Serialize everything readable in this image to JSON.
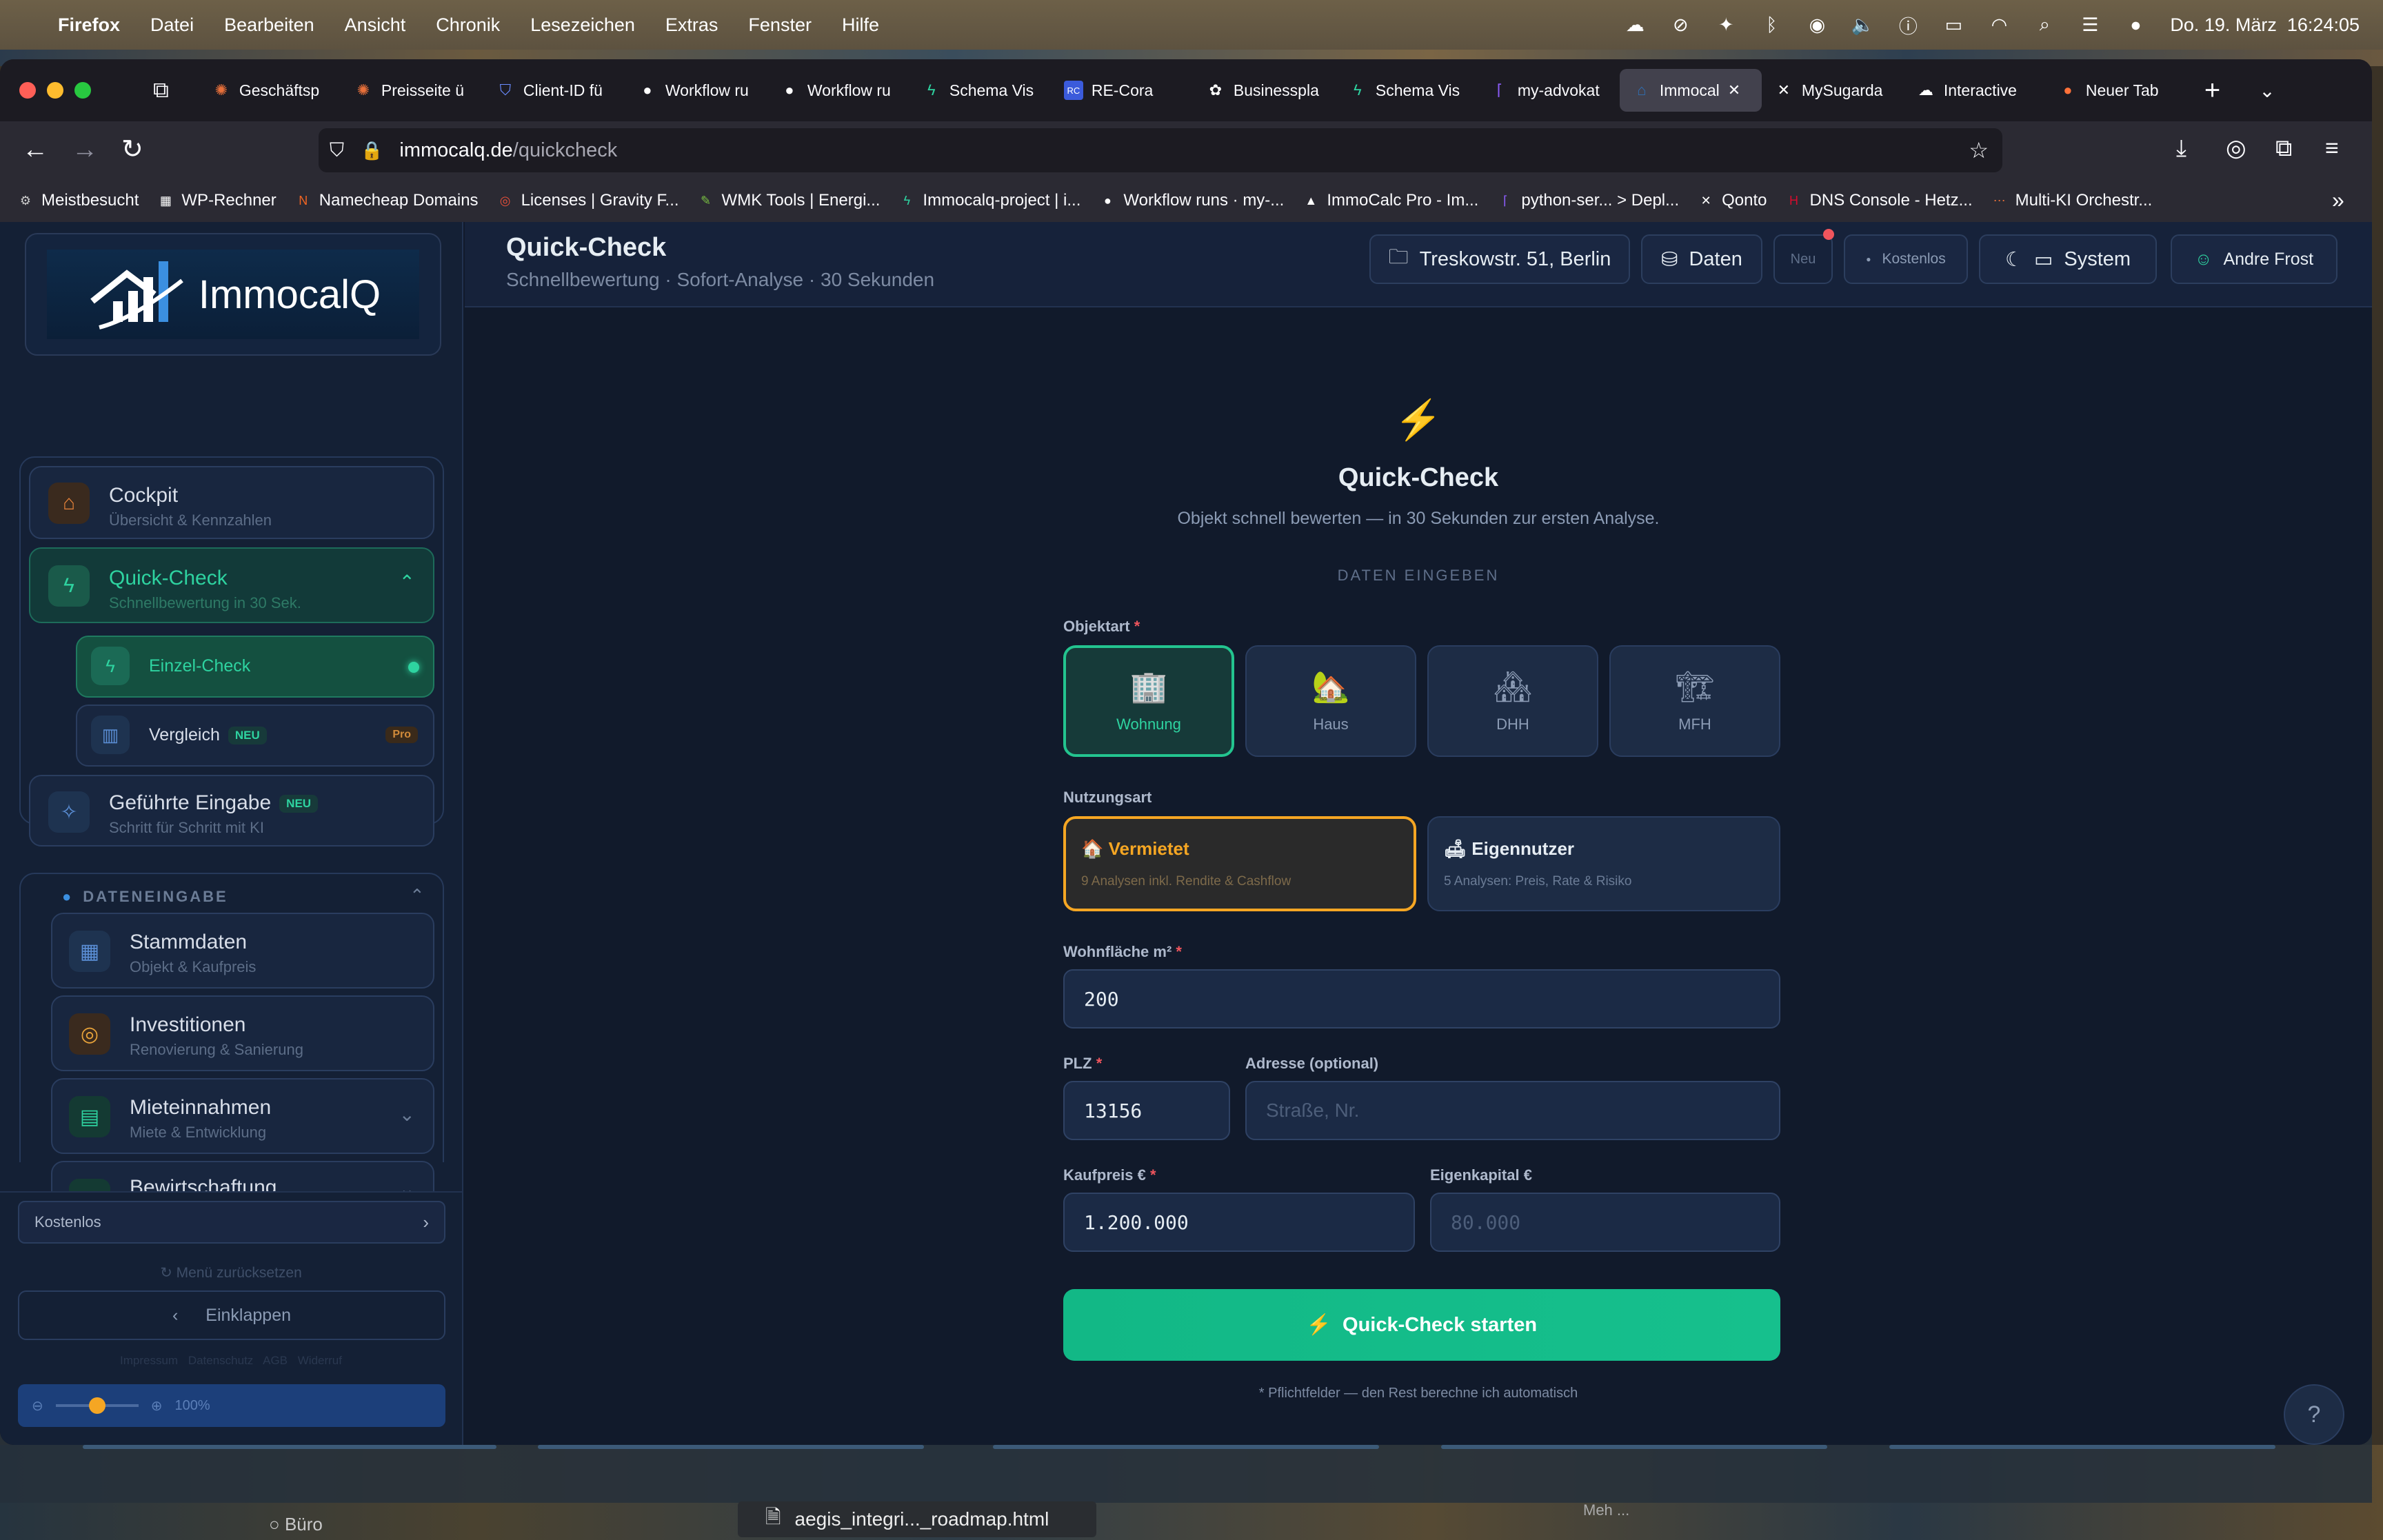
{
  "menubar": {
    "app": "Firefox",
    "items": [
      "Datei",
      "Bearbeiten",
      "Ansicht",
      "Chronik",
      "Lesezeichen",
      "Extras",
      "Fenster",
      "Hilfe"
    ],
    "clock": "Do. 19. März  16:24:05"
  },
  "tabs": [
    {
      "label": "Geschäftsp",
      "icon": "sparkle-icon",
      "color": "#e8703a"
    },
    {
      "label": "Preisseite ü",
      "icon": "sparkle-icon",
      "color": "#e8703a"
    },
    {
      "label": "Client-ID fü",
      "icon": "shield-icon",
      "color": "#6a8cff"
    },
    {
      "label": "Workflow ru",
      "icon": "github-icon",
      "color": "#ffffff"
    },
    {
      "label": "Workflow ru",
      "icon": "github-icon",
      "color": "#ffffff"
    },
    {
      "label": "Schema Vis",
      "icon": "bolt-icon",
      "color": "#2ed3a0"
    },
    {
      "label": "RE-Cora",
      "icon": "rc-icon",
      "color": "#3b5bdb"
    },
    {
      "label": "Businesspla",
      "icon": "openai-icon",
      "color": "#ffffff"
    },
    {
      "label": "Schema Vis",
      "icon": "bolt-icon",
      "color": "#2ed3a0"
    },
    {
      "label": "my-advokat",
      "icon": "bracket-icon",
      "color": "#8a5cf6"
    },
    {
      "label": "Immocal",
      "icon": "immocalq-icon",
      "color": "#2f6fb5"
    },
    {
      "label": "MySugarda",
      "icon": "x-icon",
      "color": "#ffffff"
    },
    {
      "label": "Interactive",
      "icon": "cloud-icon",
      "color": "#ffffff"
    },
    {
      "label": "Neuer Tab",
      "icon": "firefox-icon",
      "color": "#ff7139"
    }
  ],
  "url": {
    "domain": "immocalq.de",
    "path": "/quickcheck"
  },
  "bookmarks": [
    {
      "label": "Meistbesucht",
      "icon": "gear-icon",
      "color": "#cccccc"
    },
    {
      "label": "WP-Rechner",
      "icon": "page-icon",
      "color": "#ffffff"
    },
    {
      "label": "Namecheap Domains",
      "icon": "n-icon",
      "color": "#f26522"
    },
    {
      "label": "Licenses | Gravity F...",
      "icon": "gravity-icon",
      "color": "#e8503a"
    },
    {
      "label": "WMK Tools | Energi...",
      "icon": "leaf-icon",
      "color": "#7ac143"
    },
    {
      "label": "Immocalq-project | i...",
      "icon": "bolt-icon",
      "color": "#2ed3a0"
    },
    {
      "label": "Workflow runs · my-...",
      "icon": "github-icon",
      "color": "#ffffff"
    },
    {
      "label": "ImmoCalc Pro - Im...",
      "icon": "triangle-icon",
      "color": "#ffffff"
    },
    {
      "label": "python-ser... > Depl...",
      "icon": "bracket-icon",
      "color": "#8a5cf6"
    },
    {
      "label": "Qonto",
      "icon": "x-icon",
      "color": "#ffffff"
    },
    {
      "label": "DNS Console - Hetz...",
      "icon": "h-icon",
      "color": "#d50c2d"
    },
    {
      "label": "Multi-KI Orchestr...",
      "icon": "nodes-icon",
      "color": "#e8703a"
    }
  ],
  "sidebar": {
    "logo_text": "ImmocalQ",
    "nav": [
      {
        "title": "Cockpit",
        "subtitle": "Übersicht & Kennzahlen"
      },
      {
        "title": "Quick-Check",
        "subtitle": "Schnellbewertung in 30 Sek."
      },
      {
        "title": "Einzel-Check"
      },
      {
        "title": "Vergleich",
        "badge": "NEU",
        "pro": "Pro"
      },
      {
        "title": "Geführte Eingabe",
        "badge": "NEU",
        "subtitle": "Schritt für Schritt mit KI"
      }
    ],
    "section_title": "DATENEINGABE",
    "data_items": [
      {
        "title": "Stammdaten",
        "subtitle": "Objekt & Kaufpreis"
      },
      {
        "title": "Investitionen",
        "subtitle": "Renovierung & Sanierung"
      },
      {
        "title": "Mieteinnahmen",
        "subtitle": "Miete & Entwicklung"
      },
      {
        "title": "Bewirtschaftung",
        "subtitle": ""
      }
    ],
    "plan": "Kostenlos",
    "reset": "Menü zurücksetzen",
    "collapse": "Einklappen",
    "footer_links": [
      "Impressum",
      "Datenschutz",
      "AGB",
      "Widerruf"
    ],
    "zoom": "100%",
    "zoom_level": 0.5
  },
  "topbar": {
    "title": "Quick-Check",
    "subtitle": "Schnellbewertung · Sofort-Analyse · 30 Sekunden",
    "address": "Treskowstr. 51, Berlin",
    "daten": "Daten",
    "neu": "Neu",
    "plan": "Kostenlos",
    "theme": "System",
    "user": "Andre Frost"
  },
  "form": {
    "heading": "Quick-Check",
    "intro": "Objekt schnell bewerten — in 30 Sekunden zur ersten Analyse.",
    "section": "DATEN EINGEBEN",
    "objektart_label": "Objektart",
    "objektart": [
      {
        "label": "Wohnung",
        "icon": "🏢"
      },
      {
        "label": "Haus",
        "icon": "🏡"
      },
      {
        "label": "DHH",
        "icon": "🏘"
      },
      {
        "label": "MFH",
        "icon": "🏗"
      }
    ],
    "nutzung_label": "Nutzungsart",
    "nutzung": [
      {
        "title": "Vermietet",
        "desc": "9 Analysen inkl. Rendite & Cashflow",
        "icon": "🏠"
      },
      {
        "title": "Eigennutzer",
        "desc": "5 Analysen: Preis, Rate & Risiko",
        "icon": "🛋"
      }
    ],
    "flaeche_label": "Wohnfläche m²",
    "flaeche_value": "200",
    "plz_label": "PLZ",
    "plz_value": "13156",
    "adresse_label": "Adresse (optional)",
    "adresse_placeholder": "Straße, Nr.",
    "kaufpreis_label": "Kaufpreis €",
    "kaufpreis_value": "1.200.000",
    "eigenkapital_label": "Eigenkapital €",
    "eigenkapital_placeholder": "80.000",
    "submit": "Quick-Check starten",
    "footnote": "* Pflichtfelder — den Rest berechne ich automatisch",
    "help": "?"
  },
  "dock": {
    "item1": "Büro",
    "item2": "aegis_integri..._roadmap.html",
    "item3": "Meh ..."
  }
}
